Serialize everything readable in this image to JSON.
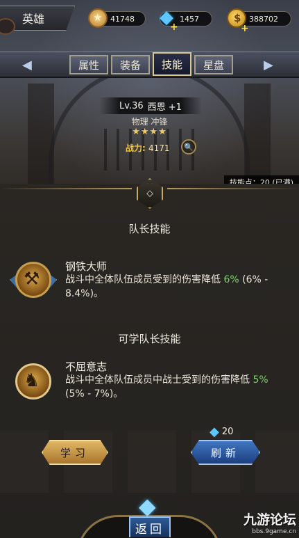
{
  "header": {
    "hero_tab_label": "英雄",
    "resources": [
      {
        "icon": "star-icon",
        "value": "41748"
      },
      {
        "icon": "diamond-icon",
        "value": "1457"
      },
      {
        "icon": "gold-coin-icon",
        "value": "388702"
      }
    ]
  },
  "tabs": [
    {
      "label": "属性",
      "active": false
    },
    {
      "label": "装备",
      "active": false
    },
    {
      "label": "技能",
      "active": true
    },
    {
      "label": "星盘",
      "active": false
    }
  ],
  "hero": {
    "level": "Lv.36",
    "name": "西恩 +1",
    "class_tags": "物理 冲锋",
    "stars": "★★★★",
    "stars_count": 4,
    "power_label": "战力:",
    "power_value": "4171",
    "skill_points": "技能点：20 (已满)"
  },
  "captain_skill": {
    "section_title": "队长技能",
    "name": "钢铁大师",
    "desc_prefix": "战斗中全体队伍成员受到的伤害降低 ",
    "desc_highlight": "6%",
    "desc_suffix": " (6% - 8.4%)。"
  },
  "learnable_skill": {
    "section_title": "可学队长技能",
    "name": "不屈意志",
    "desc_prefix": "战斗中全体队伍成员中战士受到的伤害降低 ",
    "desc_highlight": "5%",
    "desc_suffix": " (5% - 7%)。"
  },
  "actions": {
    "learn_label": "学习",
    "refresh_label": "刷新",
    "refresh_cost": "20",
    "back_label": "返回"
  },
  "watermark": {
    "title": "九游论坛",
    "url": "bbs.9game.cn"
  },
  "colors": {
    "highlight_green": "#7bd46a",
    "power_gold": "#f1c43c",
    "learn_gold": "#e0b765",
    "refresh_blue": "#3f76c0"
  }
}
